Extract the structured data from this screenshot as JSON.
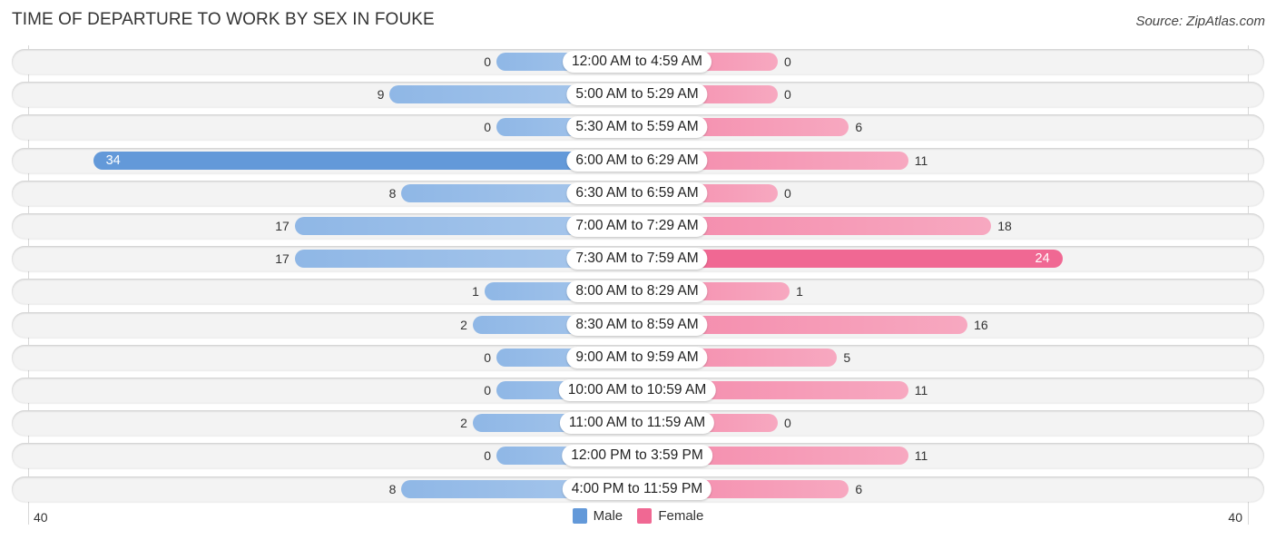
{
  "header": {
    "title": "TIME OF DEPARTURE TO WORK BY SEX IN FOUKE",
    "source": "Source: ZipAtlas.com"
  },
  "colors": {
    "male": "#6399d9",
    "male_light": "#a9c8ec",
    "female": "#f06893",
    "female_light": "#f7a8c0"
  },
  "chart_data": {
    "type": "bar",
    "orientation": "horizontal-diverging",
    "title": "TIME OF DEPARTURE TO WORK BY SEX IN FOUKE",
    "categories": [
      "12:00 AM to 4:59 AM",
      "5:00 AM to 5:29 AM",
      "5:30 AM to 5:59 AM",
      "6:00 AM to 6:29 AM",
      "6:30 AM to 6:59 AM",
      "7:00 AM to 7:29 AM",
      "7:30 AM to 7:59 AM",
      "8:00 AM to 8:29 AM",
      "8:30 AM to 8:59 AM",
      "9:00 AM to 9:59 AM",
      "10:00 AM to 10:59 AM",
      "11:00 AM to 11:59 AM",
      "12:00 PM to 3:59 PM",
      "4:00 PM to 11:59 PM"
    ],
    "series": [
      {
        "name": "Male",
        "values": [
          0,
          9,
          0,
          34,
          8,
          17,
          17,
          1,
          2,
          0,
          0,
          2,
          0,
          8
        ]
      },
      {
        "name": "Female",
        "values": [
          0,
          0,
          6,
          11,
          0,
          18,
          24,
          1,
          16,
          5,
          11,
          0,
          11,
          6
        ]
      }
    ],
    "axis": {
      "left_label": "40",
      "right_label": "40",
      "range": [
        0,
        40
      ]
    },
    "legend": {
      "position": "bottom-center",
      "entries": [
        "Male",
        "Female"
      ]
    },
    "xlabel": "",
    "ylabel": "",
    "grid": false
  }
}
